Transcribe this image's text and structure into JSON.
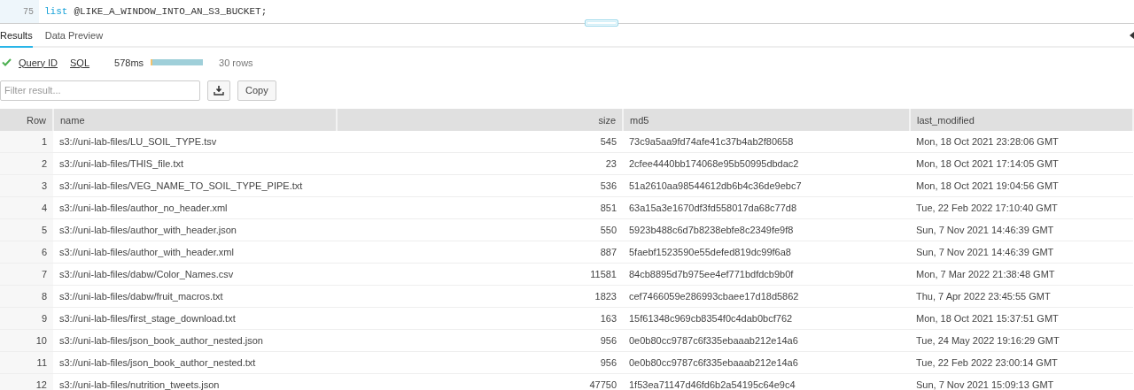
{
  "editor": {
    "line_number": "75",
    "code": [
      {
        "kind": "keyword",
        "text": "list"
      },
      {
        "kind": "plain",
        "text": "@LIKE_A_WINDOW_INTO_AN_S3_BUCKET;"
      }
    ]
  },
  "tabs": [
    {
      "label": "Results",
      "selected": true
    },
    {
      "label": "Data Preview",
      "selected": false
    }
  ],
  "status": {
    "success": true,
    "query_id": "Query ID",
    "sql": "SQL",
    "duration": "578ms",
    "rows": "30 rows"
  },
  "filter": {
    "placeholder": "Filter result..."
  },
  "copy_button": "Copy",
  "table": {
    "columns": [
      {
        "label": "Row",
        "kind": "number"
      },
      {
        "label": "name",
        "kind": "text"
      },
      {
        "label": "size",
        "kind": "number"
      },
      {
        "label": "md5",
        "kind": "text"
      },
      {
        "label": "last_modified",
        "kind": "text"
      }
    ],
    "rows": [
      [
        "1",
        "s3://uni-lab-files/LU_SOIL_TYPE.tsv",
        "545",
        "73c9a5aa9fd74afe41c37b4ab2f80658",
        "Mon, 18 Oct 2021 23:28:06 GMT"
      ],
      [
        "2",
        "s3://uni-lab-files/THIS_file.txt",
        "23",
        "2cfee4440bb174068e95b50995dbdac2",
        "Mon, 18 Oct 2021 17:14:05 GMT"
      ],
      [
        "3",
        "s3://uni-lab-files/VEG_NAME_TO_SOIL_TYPE_PIPE.txt",
        "536",
        "51a2610aa98544612db6b4c36de9ebc7",
        "Mon, 18 Oct 2021 19:04:56 GMT"
      ],
      [
        "4",
        "s3://uni-lab-files/author_no_header.xml",
        "851",
        "63a15a3e1670df3fd558017da68c77d8",
        "Tue, 22 Feb 2022 17:10:40 GMT"
      ],
      [
        "5",
        "s3://uni-lab-files/author_with_header.json",
        "550",
        "5923b488c6d7b8238ebfe8c2349fe9f8",
        "Sun, 7 Nov 2021 14:46:39 GMT"
      ],
      [
        "6",
        "s3://uni-lab-files/author_with_header.xml",
        "887",
        "5faebf1523590e55defed819dc99f6a8",
        "Sun, 7 Nov 2021 14:46:39 GMT"
      ],
      [
        "7",
        "s3://uni-lab-files/dabw/Color_Names.csv",
        "11581",
        "84cb8895d7b975ee4ef771bdfdcb9b0f",
        "Mon, 7 Mar 2022 21:38:48 GMT"
      ],
      [
        "8",
        "s3://uni-lab-files/dabw/fruit_macros.txt",
        "1823",
        "cef7466059e286993cbaee17d18d5862",
        "Thu, 7 Apr 2022 23:45:55 GMT"
      ],
      [
        "9",
        "s3://uni-lab-files/first_stage_download.txt",
        "163",
        "15f61348c969cb8354f0c4dab0bcf762",
        "Mon, 18 Oct 2021 15:37:51 GMT"
      ],
      [
        "10",
        "s3://uni-lab-files/json_book_author_nested.json",
        "956",
        "0e0b80cc9787c6f335ebaaab212e14a6",
        "Tue, 24 May 2022 19:16:29 GMT"
      ],
      [
        "11",
        "s3://uni-lab-files/json_book_author_nested.txt",
        "956",
        "0e0b80cc9787c6f335ebaaab212e14a6",
        "Tue, 22 Feb 2022 23:00:14 GMT"
      ],
      [
        "12",
        "s3://uni-lab-files/nutrition_tweets.json",
        "47750",
        "1f53ea71147d46fd6b2a54195c64e9c4",
        "Sun, 7 Nov 2021 15:09:13 GMT"
      ]
    ]
  }
}
